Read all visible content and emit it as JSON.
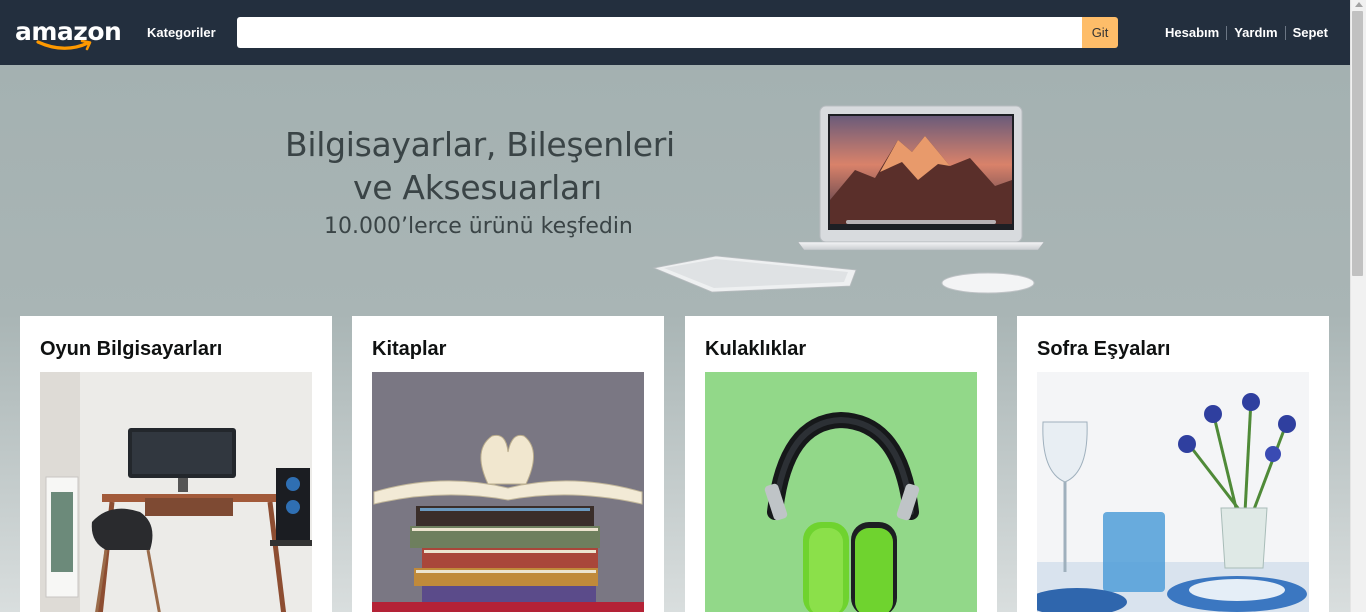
{
  "header": {
    "logo_text": "amazon",
    "categories_label": "Kategoriler",
    "search": {
      "value": "",
      "placeholder": ""
    },
    "search_button_label": "Git",
    "nav_links": [
      "Hesabım",
      "Yardım",
      "Sepet"
    ]
  },
  "hero": {
    "line1": "Bilgisayarlar, Bileşenleri",
    "line2": "ve Aksesuarları",
    "subtitle": "10.000’lerce ürünü keşfedin"
  },
  "cards": [
    {
      "title": "Oyun Bilgisayarları",
      "image": "gaming-desk-photo"
    },
    {
      "title": "Kitaplar",
      "image": "book-stack-photo"
    },
    {
      "title": "Kulaklıklar",
      "image": "headphones-photo"
    },
    {
      "title": "Sofra Eşyaları",
      "image": "tableware-photo"
    }
  ],
  "colors": {
    "header_bg": "#232f3e",
    "search_button": "#febd69",
    "logo_smile": "#ff9900"
  }
}
